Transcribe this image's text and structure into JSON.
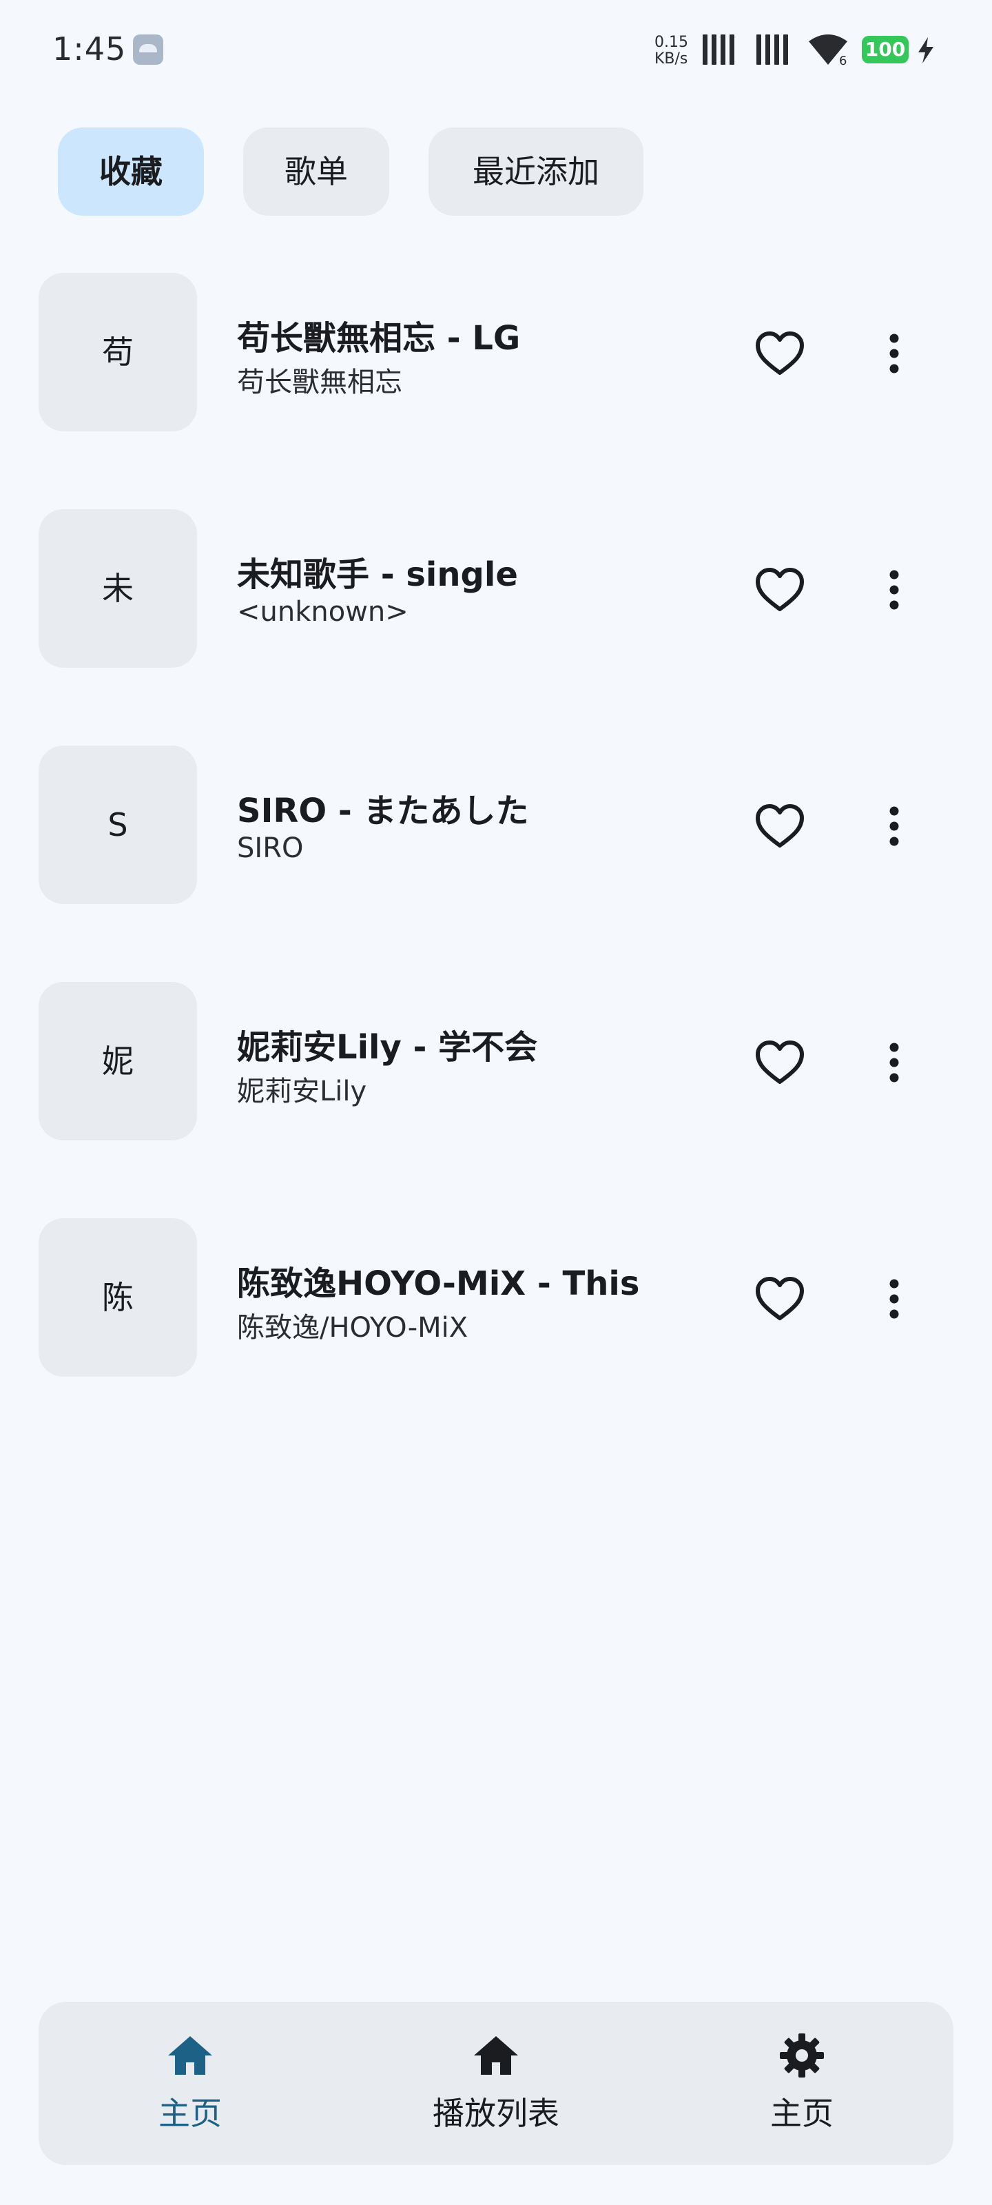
{
  "status_bar": {
    "time": "1:45",
    "net_speed_value": "0.15",
    "net_speed_unit": "KB/s",
    "wifi_sub": "6",
    "battery": "100"
  },
  "chips": [
    {
      "label": "收藏",
      "selected": true
    },
    {
      "label": "歌单",
      "selected": false
    },
    {
      "label": "最近添加",
      "selected": false
    }
  ],
  "songs": [
    {
      "art_letter": "苟",
      "title": "苟长獸無相忘 - LG",
      "artist": "苟长獸無相忘"
    },
    {
      "art_letter": "未",
      "title": "未知歌手 - single",
      "artist": "<unknown>"
    },
    {
      "art_letter": "S",
      "title": "SIRO - またあした",
      "artist": "SIRO"
    },
    {
      "art_letter": "妮",
      "title": "妮莉安Lily - 学不会",
      "artist": "妮莉安Lily"
    },
    {
      "art_letter": "陈",
      "title": "陈致逸HOYO-MiX - This",
      "artist": "陈致逸/HOYO-MiX"
    }
  ],
  "bottom_nav": [
    {
      "label": "主页",
      "icon": "home-icon",
      "active": true
    },
    {
      "label": "播放列表",
      "icon": "home-icon",
      "active": false
    },
    {
      "label": "主页",
      "icon": "gear-icon",
      "active": false
    }
  ],
  "colors": {
    "background": "#f5f8fd",
    "chip_selected": "#cce7fd",
    "surface": "#e8ebf0",
    "accent": "#1d6286",
    "battery": "#34c759"
  }
}
